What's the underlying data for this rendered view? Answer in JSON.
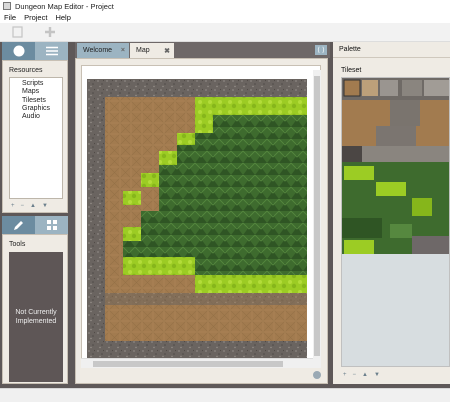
{
  "window": {
    "title": "Dungeon Map Editor - Project"
  },
  "menu": [
    "File",
    "Project",
    "Help"
  ],
  "toolbar": {
    "buttons": [
      "page-icon",
      "plus-icon"
    ]
  },
  "left_top_dock": {
    "tabs": [
      "circle-icon",
      "hamburger-icon"
    ],
    "panel_title": "Resources",
    "items": [
      "Scripts",
      "Maps",
      "Tilesets",
      "Graphics",
      "Audio"
    ],
    "controls": [
      "+",
      "−",
      "▲",
      "▼"
    ]
  },
  "left_bottom_dock": {
    "tabs": [
      "pencil-icon",
      "grid-icon"
    ],
    "panel_title": "Tools",
    "message": "Not Currently Implemented"
  },
  "center": {
    "tabs": [
      {
        "label": "Welcome",
        "close": "×"
      },
      {
        "label": "Map",
        "close": "✖"
      }
    ],
    "scroll_arrows": "⟨ ⟩"
  },
  "palette": {
    "title": "Palette",
    "tileset_label": "Tileset",
    "controls": [
      "+",
      "−",
      "▲",
      "▼"
    ]
  },
  "colors": {
    "frame": "#5e5858",
    "dock_tab": "#8ba7b6",
    "dirt": "#a27b4f",
    "grass_dark": "#3e6b2e",
    "grass_light": "#9ccc24",
    "stone": "#6f6a66"
  }
}
